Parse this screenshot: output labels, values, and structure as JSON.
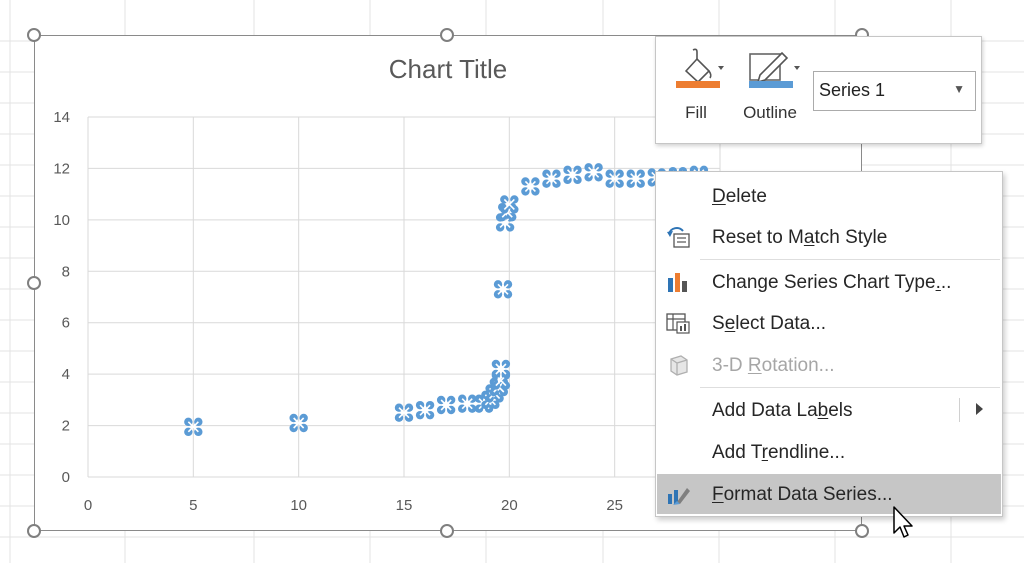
{
  "chart": {
    "title": "Chart Title"
  },
  "mini_toolbar": {
    "fill_label": "Fill",
    "outline_label": "Outline",
    "series_select_value": "Series 1",
    "fill_color": "#ED7D31",
    "outline_color": "#5B9BD5"
  },
  "context_menu": {
    "items": [
      {
        "label": "Delete",
        "underline_index": 0,
        "icon": "none",
        "enabled": true
      },
      {
        "label": "Reset to Match Style",
        "underline_index": 10,
        "icon": "reset-style-icon",
        "enabled": true
      },
      {
        "label": "Change Series Chart Type...",
        "underline_index": 24,
        "icon": "chart-type-icon",
        "enabled": true
      },
      {
        "label": "Select Data...",
        "underline_index": 1,
        "icon": "select-data-icon",
        "enabled": true
      },
      {
        "label": "3-D Rotation...",
        "underline_index": 4,
        "icon": "3d-rotation-icon",
        "enabled": false
      },
      {
        "label": "Add Data Labels",
        "underline_index": 11,
        "icon": "none",
        "enabled": true,
        "submenu": true
      },
      {
        "label": "Add Trendline...",
        "underline_index": 5,
        "icon": "none",
        "enabled": true
      },
      {
        "label": "Format Data Series...",
        "underline_index": 0,
        "icon": "format-series-icon",
        "enabled": true,
        "selected": true
      }
    ]
  },
  "chart_data": {
    "type": "scatter",
    "title": "Chart Title",
    "xlim": [
      0,
      30
    ],
    "ylim": [
      0,
      14
    ],
    "x_ticks": [
      0,
      5,
      10,
      15,
      20,
      25
    ],
    "y_ticks": [
      0,
      2,
      4,
      6,
      8,
      10,
      12,
      14
    ],
    "grid": true,
    "marker_color": "#5B9BD5",
    "series": [
      {
        "points": [
          [
            5,
            1.95
          ],
          [
            10,
            2.1
          ],
          [
            15,
            2.5
          ],
          [
            16,
            2.6
          ],
          [
            17,
            2.8
          ],
          [
            18,
            2.85
          ],
          [
            18.8,
            2.85
          ],
          [
            19.1,
            3.0
          ],
          [
            19.3,
            3.25
          ],
          [
            19.5,
            3.5
          ],
          [
            19.6,
            3.75
          ],
          [
            19.6,
            4.2
          ],
          [
            19.7,
            7.3
          ],
          [
            19.8,
            9.9
          ],
          [
            19.9,
            10.3
          ],
          [
            20,
            10.6
          ],
          [
            21,
            11.3
          ],
          [
            22,
            11.6
          ],
          [
            23,
            11.75
          ],
          [
            24,
            11.85
          ],
          [
            25,
            11.6
          ],
          [
            26,
            11.6
          ],
          [
            27,
            11.65
          ],
          [
            28,
            11.7
          ],
          [
            29,
            11.75
          ]
        ]
      }
    ]
  }
}
